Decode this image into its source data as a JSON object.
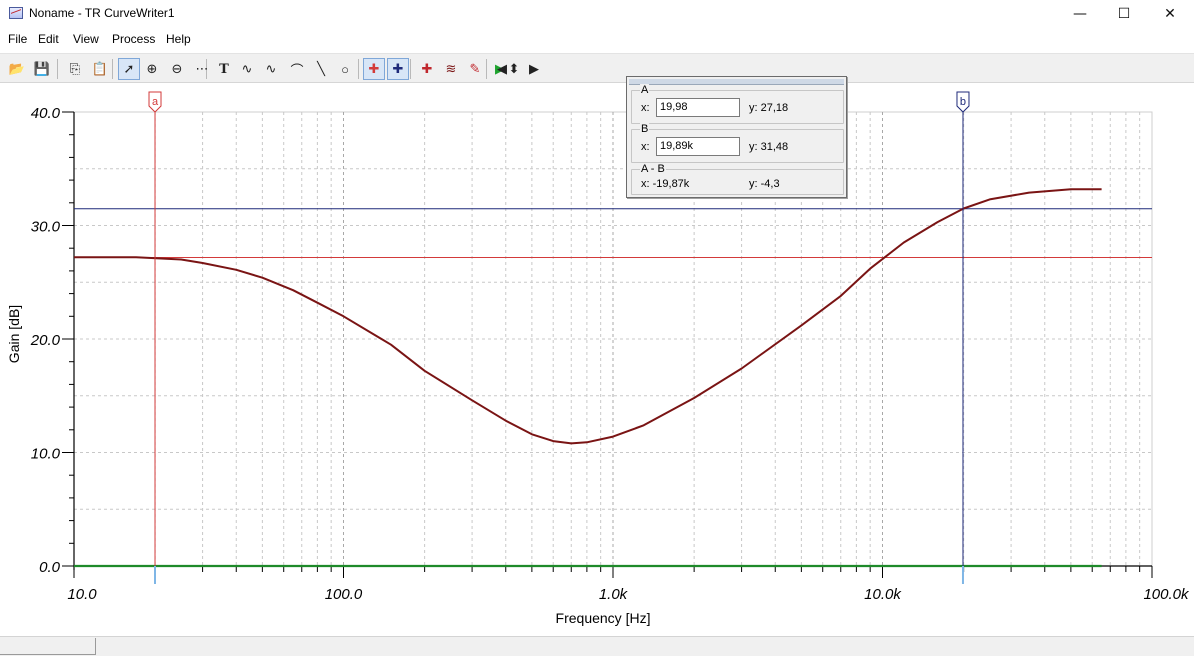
{
  "window": {
    "title": "Noname - TR CurveWriter1",
    "min_glyph": "—",
    "max_glyph": "☐",
    "close_glyph": "✕"
  },
  "menu": [
    "File",
    "Edit",
    "View",
    "Process",
    "Help"
  ],
  "toolbar": {
    "buttons": [
      {
        "icon": "open-folder-icon",
        "glyph": "📂"
      },
      {
        "icon": "save-disk-icon",
        "glyph": "💾"
      },
      {
        "icon": "copy-icon",
        "glyph": "⎘"
      },
      {
        "icon": "paste-icon",
        "glyph": "📋"
      },
      {
        "icon": "pointer-icon",
        "glyph": "➚"
      },
      {
        "icon": "zoom-in-icon",
        "glyph": "⊕"
      },
      {
        "icon": "zoom-100-icon",
        "glyph": "⊖"
      },
      {
        "icon": "grid-icon",
        "glyph": "⋯"
      },
      {
        "icon": "text-icon",
        "glyph": "T"
      },
      {
        "icon": "curve-tool-1-icon",
        "glyph": "∿"
      },
      {
        "icon": "curve-tool-2-icon",
        "glyph": "∿"
      },
      {
        "icon": "curve-tool-3-icon",
        "glyph": "⌒"
      },
      {
        "icon": "line-icon",
        "glyph": "╲"
      },
      {
        "icon": "circle-icon",
        "glyph": "○"
      },
      {
        "icon": "cursor-a-icon",
        "glyph": "✚"
      },
      {
        "icon": "cursor-b-icon",
        "glyph": "✚"
      },
      {
        "icon": "add-marker-icon",
        "glyph": "✚"
      },
      {
        "icon": "waveform-icon",
        "glyph": "≋"
      },
      {
        "icon": "probe-icon",
        "glyph": "✎"
      },
      {
        "icon": "run-icon",
        "glyph": "▶"
      },
      {
        "icon": "step-left-icon",
        "glyph": "◀"
      },
      {
        "icon": "step-updown-icon",
        "glyph": "⬍"
      },
      {
        "icon": "step-right-icon",
        "glyph": "▶"
      }
    ]
  },
  "readout": {
    "a_label": "A",
    "a_x": "19,98",
    "a_y": "y: 27,18",
    "b_label": "B",
    "b_x": "19,89k",
    "b_y": "y: 31,48",
    "diff_label": "A - B",
    "diff_x": "x:  -19,87k",
    "diff_y": "y: -4,3",
    "x_prefix": "x:"
  },
  "cursors": {
    "a": {
      "label": "a",
      "x": 19.98,
      "y": 27.18,
      "color": "#d33a3a"
    },
    "b": {
      "label": "b",
      "x": 19890,
      "y": 31.48,
      "color": "#1f2a7a"
    }
  },
  "chart_data": {
    "type": "line",
    "xlabel": "Frequency [Hz]",
    "ylabel": "Gain [dB]",
    "x_scale": "log",
    "xlim": [
      10,
      100000
    ],
    "ylim": [
      0,
      40
    ],
    "x_ticks": [
      {
        "v": 10,
        "label": "10.0"
      },
      {
        "v": 100,
        "label": "100.0"
      },
      {
        "v": 1000,
        "label": "1.0k"
      },
      {
        "v": 10000,
        "label": "10.0k"
      },
      {
        "v": 100000,
        "label": "100.0k"
      }
    ],
    "y_ticks": [
      {
        "v": 0,
        "label": "0.0"
      },
      {
        "v": 10,
        "label": "10.0"
      },
      {
        "v": 20,
        "label": "20.0"
      },
      {
        "v": 30,
        "label": "30.0"
      },
      {
        "v": 40,
        "label": "40.0"
      }
    ],
    "grid": true,
    "series": [
      {
        "color": "#7a1414",
        "points": [
          [
            10,
            27.2
          ],
          [
            17,
            27.2
          ],
          [
            25,
            27.0
          ],
          [
            30,
            26.7
          ],
          [
            40,
            26.1
          ],
          [
            50,
            25.4
          ],
          [
            65,
            24.3
          ],
          [
            80,
            23.2
          ],
          [
            100,
            22.0
          ],
          [
            150,
            19.5
          ],
          [
            200,
            17.2
          ],
          [
            300,
            14.6
          ],
          [
            400,
            12.8
          ],
          [
            500,
            11.6
          ],
          [
            600,
            11.0
          ],
          [
            700,
            10.8
          ],
          [
            800,
            10.9
          ],
          [
            1000,
            11.4
          ],
          [
            1300,
            12.4
          ],
          [
            2000,
            14.8
          ],
          [
            3000,
            17.4
          ],
          [
            5000,
            21.2
          ],
          [
            7000,
            23.8
          ],
          [
            9000,
            26.2
          ],
          [
            12000,
            28.5
          ],
          [
            16000,
            30.3
          ],
          [
            20000,
            31.5
          ],
          [
            25000,
            32.3
          ],
          [
            35000,
            32.9
          ],
          [
            50000,
            33.2
          ],
          [
            65000,
            33.2
          ]
        ]
      },
      {
        "color": "#1e8a2a",
        "points": [
          [
            10,
            0
          ],
          [
            65000,
            0
          ]
        ]
      }
    ]
  }
}
